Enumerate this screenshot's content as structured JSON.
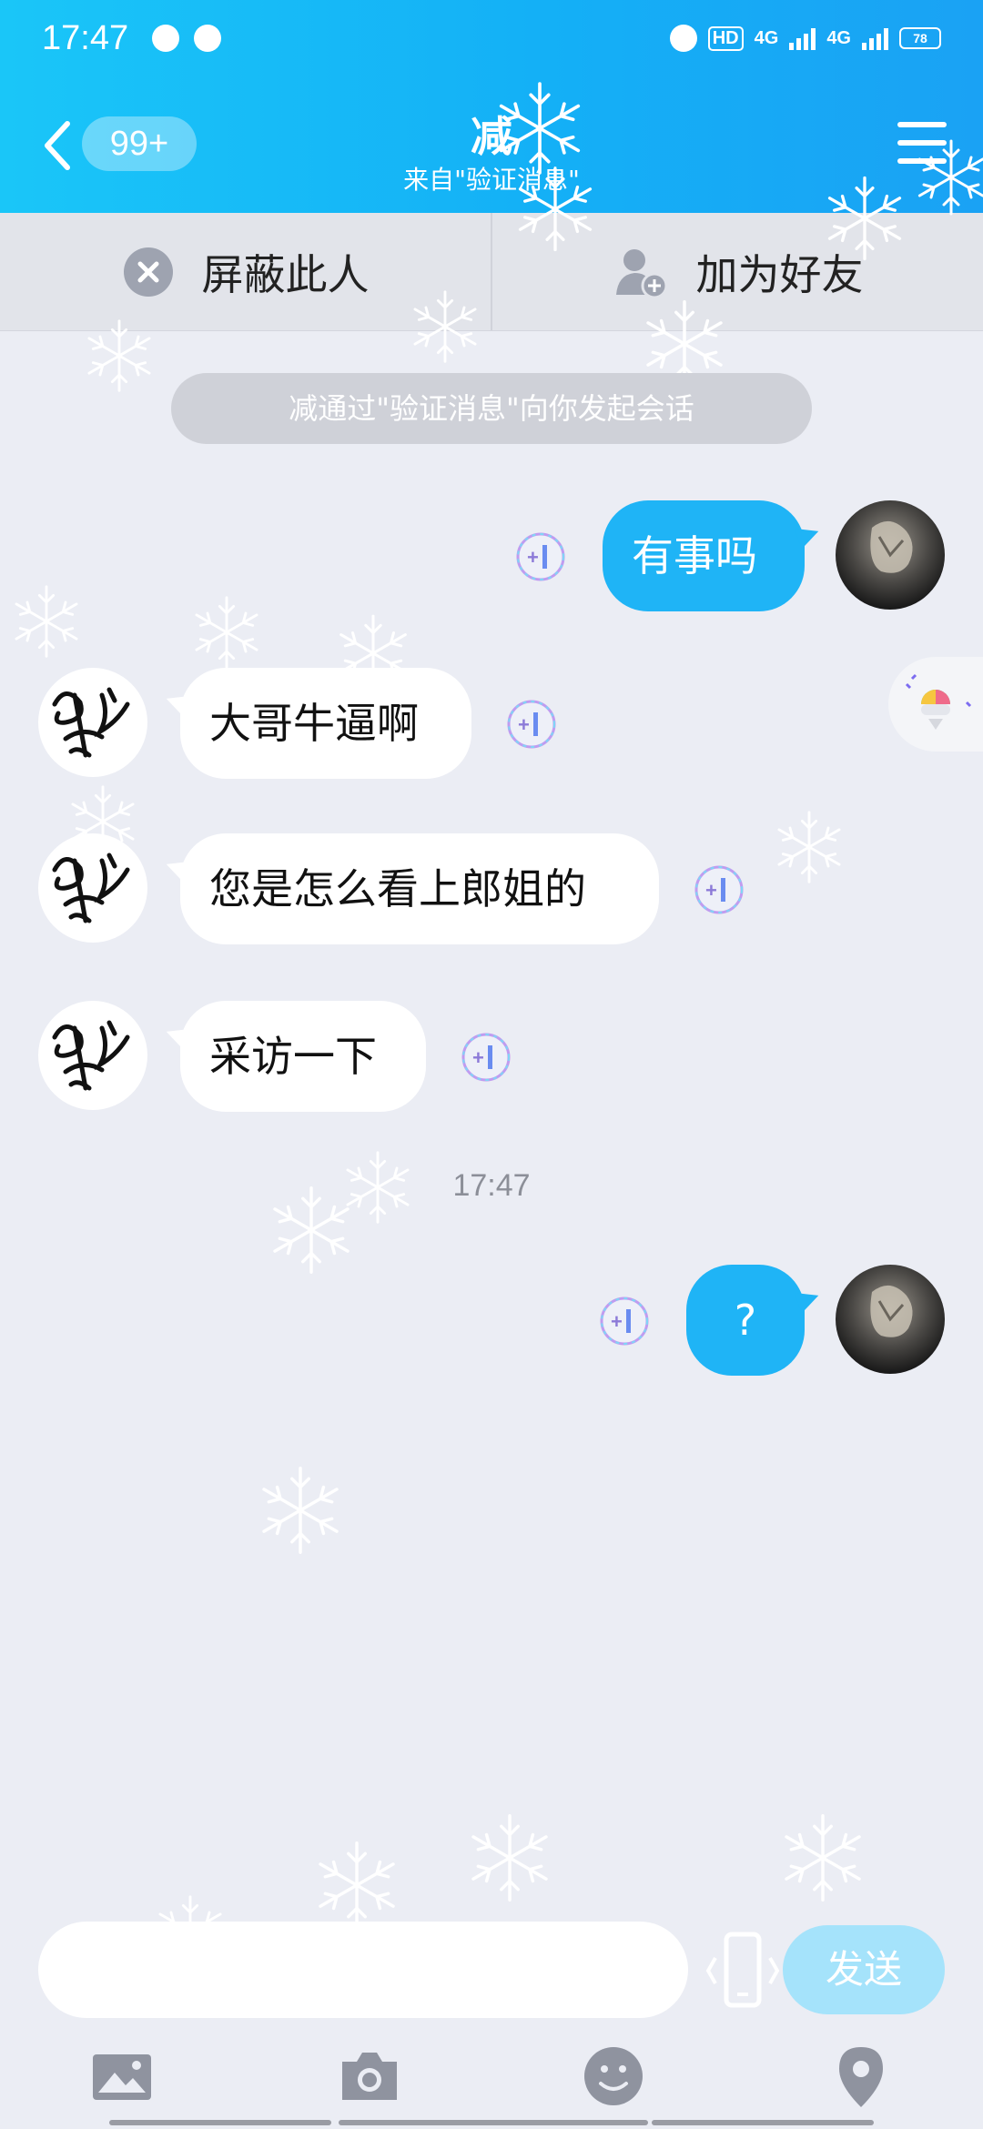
{
  "status_bar": {
    "time": "17:47",
    "network_1": "4G",
    "network_2": "4G",
    "hd_label": "HD",
    "battery_level": "78"
  },
  "header": {
    "unread_count": "99+",
    "title": "减",
    "subtitle": "来自\"验证消息\""
  },
  "actions": {
    "block_label": "屏蔽此人",
    "add_friend_label": "加为好友"
  },
  "system_notice": "减通过\"验证消息\"向你发起会话",
  "messages": [
    {
      "from": "me",
      "text": "有事吗"
    },
    {
      "from": "other",
      "text": "大哥牛逼啊"
    },
    {
      "from": "other",
      "text": "您是怎么看上郎姐的"
    },
    {
      "from": "other",
      "text": "采访一下"
    },
    {
      "from": "me",
      "text": "?"
    }
  ],
  "time_divider": "17:47",
  "composer": {
    "input_value": "",
    "send_label": "发送"
  },
  "toolbar_icons": [
    "image-icon",
    "camera-icon",
    "emoji-icon",
    "location-icon"
  ],
  "colors": {
    "header_start": "#1ac6f8",
    "header_end": "#1aa2f4",
    "my_bubble": "#1fb4f6",
    "background": "#ebedf4",
    "send_button": "#a5e3fb"
  }
}
